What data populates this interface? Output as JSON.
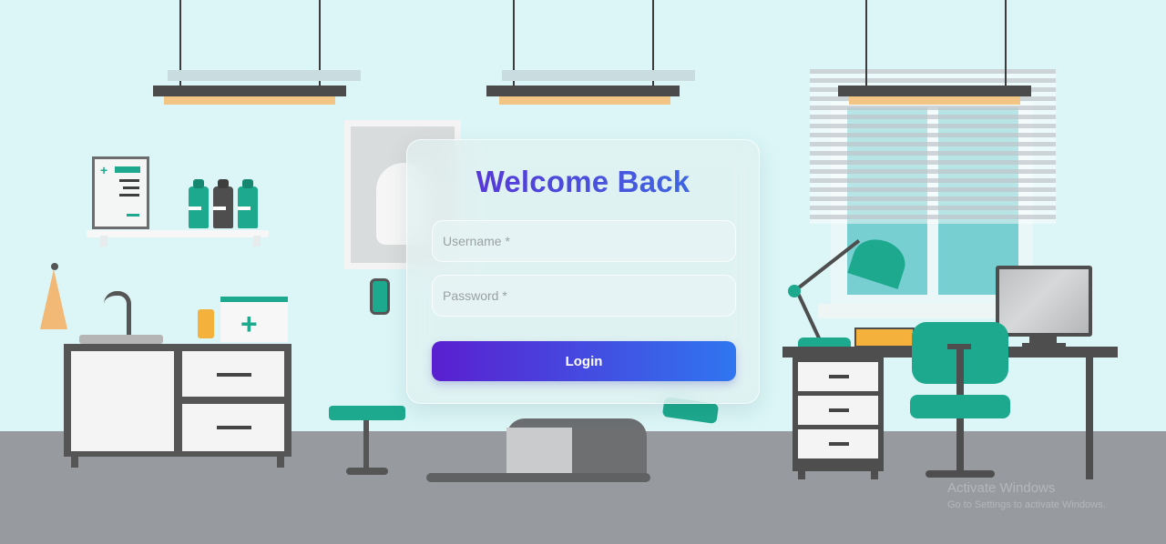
{
  "login": {
    "title": "Welcome Back",
    "username_placeholder": "Username *",
    "password_placeholder": "Password *",
    "submit_label": "Login"
  },
  "watermark": {
    "line1": "Activate Windows",
    "line2": "Go to Settings to activate Windows."
  },
  "colors": {
    "accent_start": "#5a1fd0",
    "accent_end": "#2f76f0",
    "scene_teal": "#1ca98d",
    "wall": "#dcf6f7",
    "floor": "#979b9f"
  },
  "icons": {
    "medical_cross": "+"
  }
}
